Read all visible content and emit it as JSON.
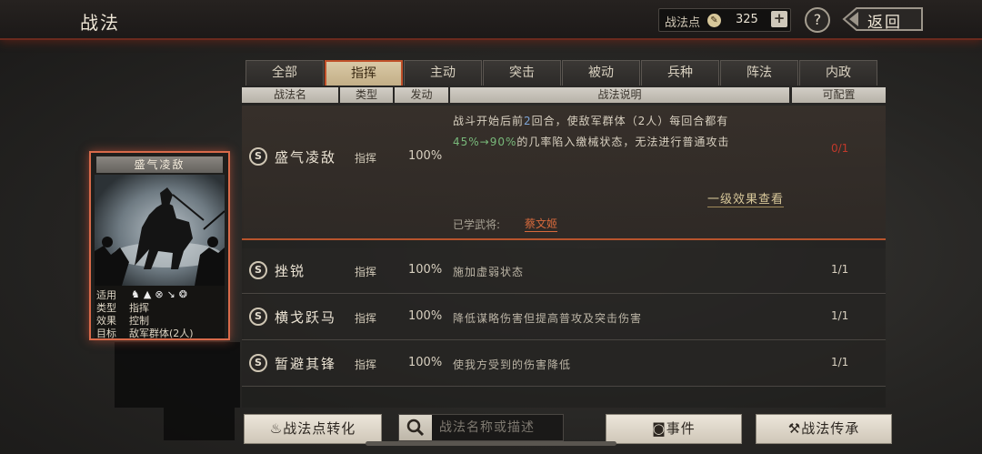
{
  "header": {
    "title": "战法",
    "points_label": "战法点",
    "points_value": "325",
    "plus_label": "+",
    "help_label": "?",
    "back_label": "返回"
  },
  "tabs": [
    {
      "label": "全部",
      "active": false
    },
    {
      "label": "指挥",
      "active": true
    },
    {
      "label": "主动",
      "active": false
    },
    {
      "label": "突击",
      "active": false
    },
    {
      "label": "被动",
      "active": false
    },
    {
      "label": "兵种",
      "active": false
    },
    {
      "label": "阵法",
      "active": false
    },
    {
      "label": "内政",
      "active": false
    }
  ],
  "columns": {
    "name": "战法名",
    "type": "类型",
    "rate": "发动",
    "desc": "战法说明",
    "count": "可配置"
  },
  "expanded_row": {
    "badge": "S",
    "name": "盛气凌敌",
    "type": "指挥",
    "rate": "100%",
    "desc_1a": "战斗开始后前",
    "desc_1b": "2",
    "desc_1c": "回合，使敌军群体（2人）每回合都有",
    "desc_2a": "45%→90%",
    "desc_2b": "的几率陷入缴械状态，无法进行普通攻击",
    "count": "0/1",
    "effect_link": "一级效果查看",
    "learned_label": "已学武将:",
    "learned_name": "蔡文姬"
  },
  "rows": [
    {
      "badge": "S",
      "name": "挫锐",
      "type": "指挥",
      "rate": "100%",
      "desc": "施加虚弱状态",
      "count": "1/1"
    },
    {
      "badge": "S",
      "name": "横戈跃马",
      "type": "指挥",
      "rate": "100%",
      "desc": "降低谋略伤害但提高普攻及突击伤害",
      "count": "1/1"
    },
    {
      "badge": "S",
      "name": "暂避其锋",
      "type": "指挥",
      "rate": "100%",
      "desc": "使我方受到的伤害降低",
      "count": "1/1"
    }
  ],
  "card": {
    "title": "盛气凌敌",
    "apply_key": "适用",
    "apply_icons": "♞▲⊗↘❂",
    "type_key": "类型",
    "type_value": "指挥",
    "effect_key": "效果",
    "effect_value": "控制",
    "target_key": "目标",
    "target_value": "敌军群体(2人)"
  },
  "bottom": {
    "convert_label": "战法点转化",
    "search_placeholder": "战法名称或描述",
    "event_label": "事件",
    "inherit_label": "战法传承"
  },
  "colors": {
    "accent": "#c0502a",
    "highlight_green": "#78b87a",
    "highlight_blue": "#7da4d6",
    "count_red": "#c0392b"
  }
}
